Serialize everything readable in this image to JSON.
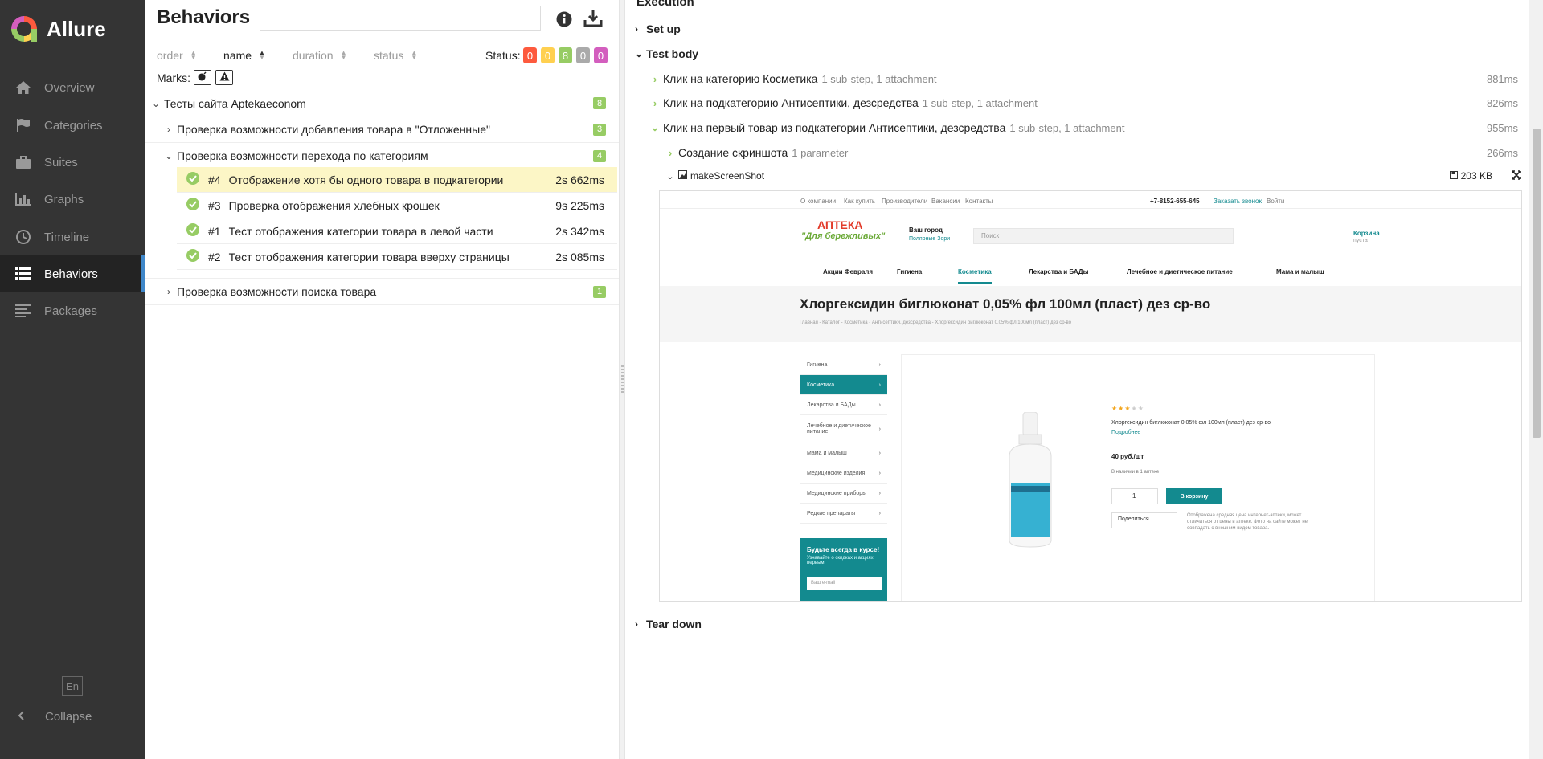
{
  "sidebar": {
    "logo_text": "Allure",
    "items": [
      {
        "label": "Overview",
        "icon": "home-icon"
      },
      {
        "label": "Categories",
        "icon": "flag-icon"
      },
      {
        "label": "Suites",
        "icon": "briefcase-icon"
      },
      {
        "label": "Graphs",
        "icon": "bar-chart-icon"
      },
      {
        "label": "Timeline",
        "icon": "clock-icon"
      },
      {
        "label": "Behaviors",
        "icon": "list-icon"
      },
      {
        "label": "Packages",
        "icon": "align-left-icon"
      }
    ],
    "active": "Behaviors",
    "lang": "En",
    "collapse_label": "Collapse"
  },
  "left": {
    "title": "Behaviors",
    "search_value": "",
    "sorters": [
      {
        "label": "order"
      },
      {
        "label": "name"
      },
      {
        "label": "duration"
      },
      {
        "label": "status"
      }
    ],
    "status_label": "Status:",
    "status_counts": [
      {
        "value": "0",
        "color": "#fd5a3e"
      },
      {
        "value": "0",
        "color": "#ffd050"
      },
      {
        "value": "8",
        "color": "#97cc64"
      },
      {
        "value": "0",
        "color": "#aaaaaa"
      },
      {
        "value": "0",
        "color": "#d35ebe"
      }
    ],
    "marks_label": "Marks:",
    "tree": {
      "root": {
        "label": "Тесты сайта Aptekaeconom",
        "count": "8"
      },
      "groups": [
        {
          "label": "Проверка возможности добавления товара в \"Отложенные\"",
          "count": "3"
        },
        {
          "label": "Проверка возможности перехода по категориям",
          "count": "4"
        },
        {
          "label": "Проверка возможности поиска товара",
          "count": "1"
        }
      ],
      "leaves": [
        {
          "num": "#4",
          "label": "Отображение хотя бы одного товара в подкатегории",
          "duration": "2s 662ms"
        },
        {
          "num": "#3",
          "label": "Проверка отображения хлебных крошек",
          "duration": "9s 225ms"
        },
        {
          "num": "#1",
          "label": "Тест отображения категории товара в левой части",
          "duration": "2s 342ms"
        },
        {
          "num": "#2",
          "label": "Тест отображения категории товара вверху страницы",
          "duration": "2s 085ms"
        }
      ]
    }
  },
  "right": {
    "execution_title": "Execution",
    "setup_label": "Set up",
    "body_label": "Test body",
    "teardown_label": "Tear down",
    "steps": [
      {
        "label": "Клик на категорию Косметика",
        "meta": "1 sub-step, 1 attachment",
        "duration": "881ms"
      },
      {
        "label": "Клик на подкатегорию Антисептики, дезсредства",
        "meta": "1 sub-step, 1 attachment",
        "duration": "826ms"
      },
      {
        "label": "Клик на первый товар из подкатегории Антисептики, дезсредства",
        "meta": "1 sub-step, 1 attachment",
        "duration": "955ms"
      },
      {
        "label": "Создание скриншота",
        "meta": "1 parameter",
        "duration": "266ms"
      }
    ],
    "attachment": {
      "name": "makeScreenShot",
      "size": "203 KB"
    },
    "screenshot": {
      "top_links": [
        "О компании",
        "Как купить",
        "Производители",
        "Вакансии",
        "Контакты"
      ],
      "phone": "+7-8152-655-645",
      "callback": "Заказать звонок",
      "login": "Войти",
      "brand_line1": "АПТЕКА",
      "brand_line2": "\"Для бережливых\"",
      "city_label": "Ваш город",
      "city_value": "Полярные Зори",
      "search_placeholder": "Поиск",
      "cart_label": "Корзина",
      "cart_sub": "пуста",
      "menu": [
        "Акции Февраля",
        "Гигиена",
        "Косметика",
        "Лекарства и БАДы",
        "Лечебное и диетическое питание",
        "Мама и малыш"
      ],
      "product_title": "Хлоргексидин биглюконат 0,05% фл 100мл (пласт) дез ср-во",
      "breadcrumbs": "Главная - Каталог - Косметика - Антисептики, дезсредства - Хлоргексидин биглюконат 0,05% фл 100мл (пласт) дез ср-во",
      "categories": [
        "Гигиена",
        "Косметика",
        "Лекарства и БАДы",
        "Лечебное и диетическое питание",
        "Мама и малыш",
        "Медицинские изделия",
        "Медицинские приборы",
        "Редкие препараты"
      ],
      "subscribe_title": "Будьте всегда в курсе!",
      "subscribe_text": "Узнавайте о скидках и акциях первым",
      "subscribe_placeholder": "Ваш e-mail",
      "product_desc": "Хлоргексидин биглюконат 0,05% фл 100мл (пласт) дез ср-во",
      "more_link": "Подробнее",
      "price": "40 руб./шт",
      "availability": "В наличии в 1 аптеке",
      "qty": "1",
      "buy_button": "В корзину",
      "share_label": "Поделиться",
      "note": "Отображена средняя цена интернет-аптеки, может отличаться от цены в аптеке. Фото на сайте может не совпадать с внешним видом товара.",
      "rating": 3
    }
  }
}
